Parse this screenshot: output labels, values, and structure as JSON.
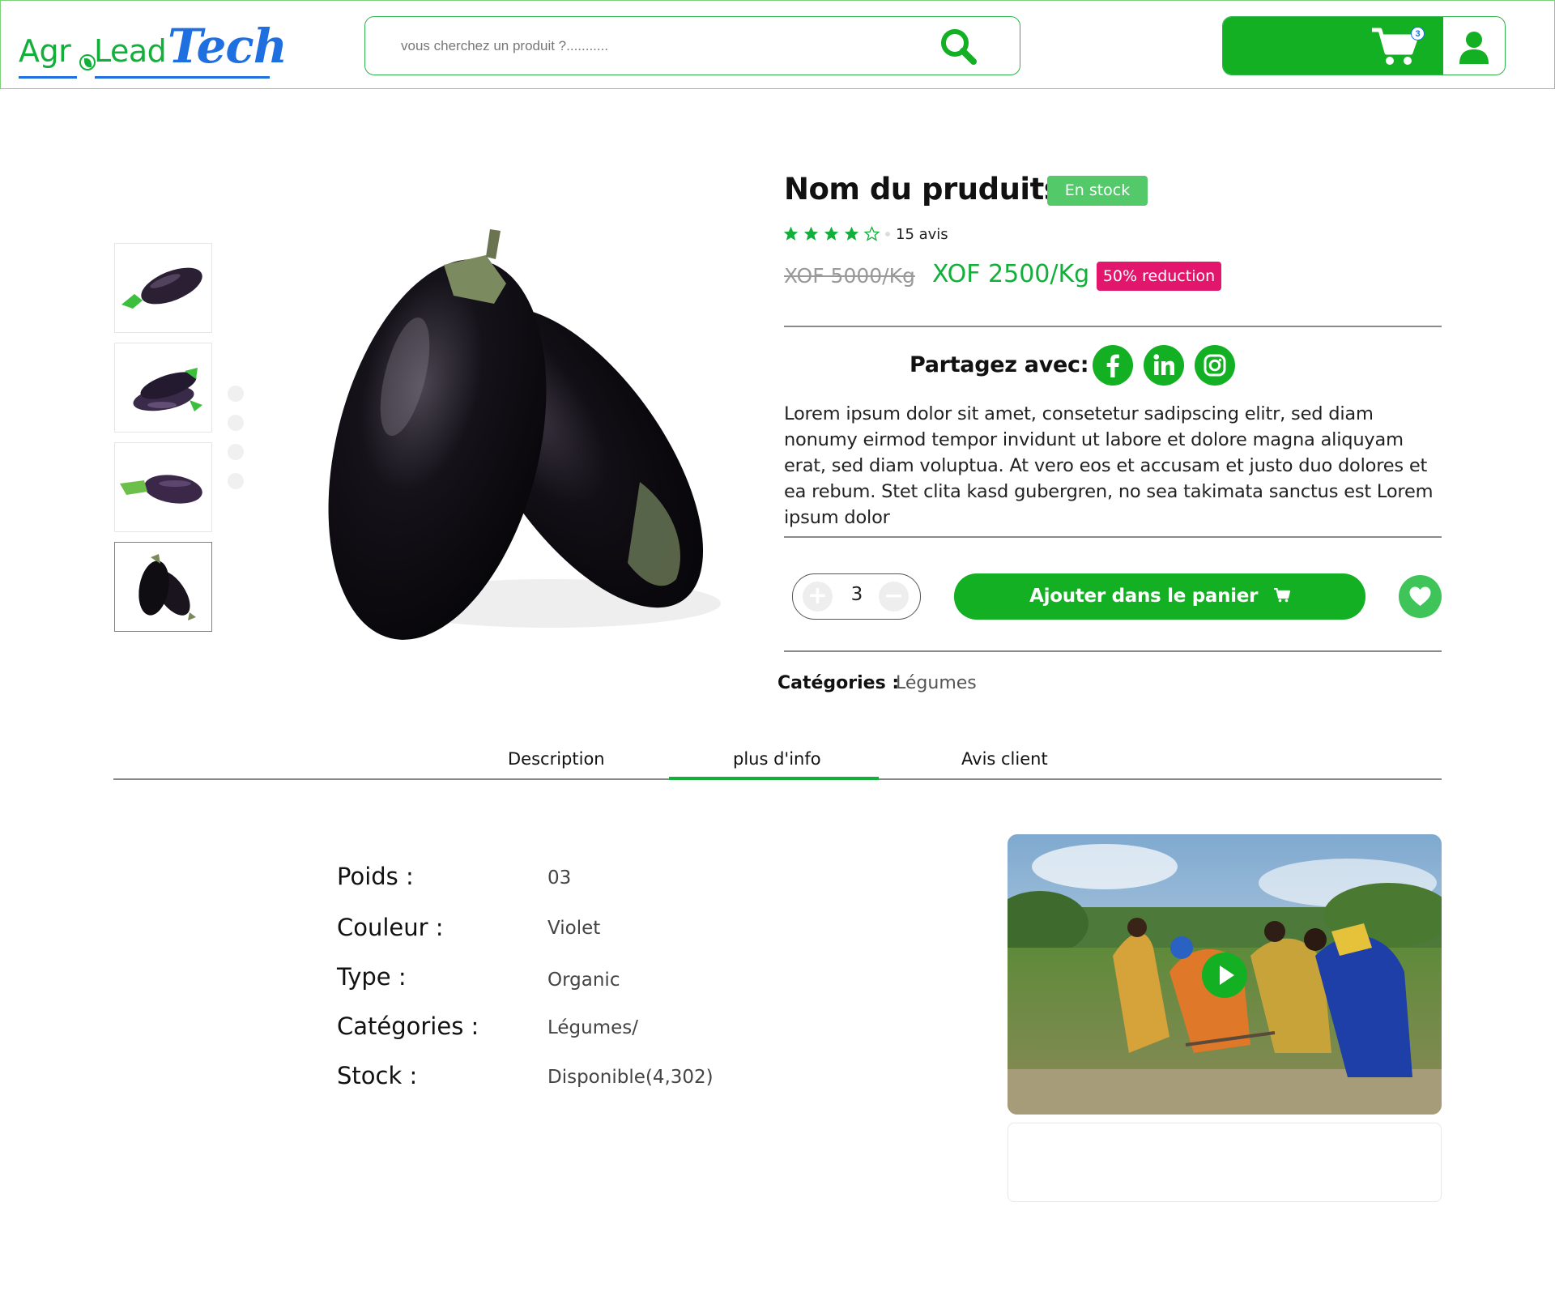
{
  "header": {
    "logo": {
      "part1": "Agr",
      "part2": "Lead",
      "part3": "Tech"
    },
    "search": {
      "placeholder": "vous cherchez un produit ?..........."
    },
    "cart": {
      "count": "3"
    }
  },
  "colors": {
    "brand_green": "#12b022",
    "accent_blue": "#1e6fe0",
    "discount_pink": "#e3166d",
    "stock_green": "#53c96a"
  },
  "gallery": {
    "thumbnails": [
      "eggplant-single",
      "eggplant-pile",
      "eggplant-lying",
      "eggplant-pair"
    ],
    "active_index": 3
  },
  "product": {
    "name": "Nom du pruduits",
    "stock_status": "En stock",
    "rating": 4,
    "rating_max": 5,
    "reviews": "15 avis",
    "old_price": "XOF 5000/Kg",
    "price": "XOF 2500/Kg",
    "discount": "50% reduction",
    "share_label": "Partagez avec:",
    "social": [
      "facebook-icon",
      "linkedin-icon",
      "instagram-icon"
    ],
    "description": "Lorem ipsum dolor sit amet, consetetur sadipscing elitr, sed diam nonumy eirmod tempor invidunt ut labore et dolore magna aliquyam erat, sed diam voluptua. At vero eos et accusam et justo duo dolores et ea rebum. Stet clita kasd gubergren, no sea takimata sanctus est Lorem ipsum dolor",
    "quantity": "3",
    "add_to_cart": "Ajouter dans le panier",
    "categories_label": "Catégories :",
    "categories_value": "Légumes"
  },
  "tabs": {
    "items": [
      "Description",
      "plus d'info",
      "Avis client"
    ],
    "active": "plus d'info"
  },
  "info": {
    "rows": [
      {
        "label": "Poids :",
        "value": "03"
      },
      {
        "label": "Couleur :",
        "value": "Violet"
      },
      {
        "label": "Type :",
        "value": "Organic"
      },
      {
        "label": "Catégories :",
        "value": "Légumes/"
      },
      {
        "label": "Stock :",
        "value": "Disponible(4,302)"
      }
    ]
  }
}
